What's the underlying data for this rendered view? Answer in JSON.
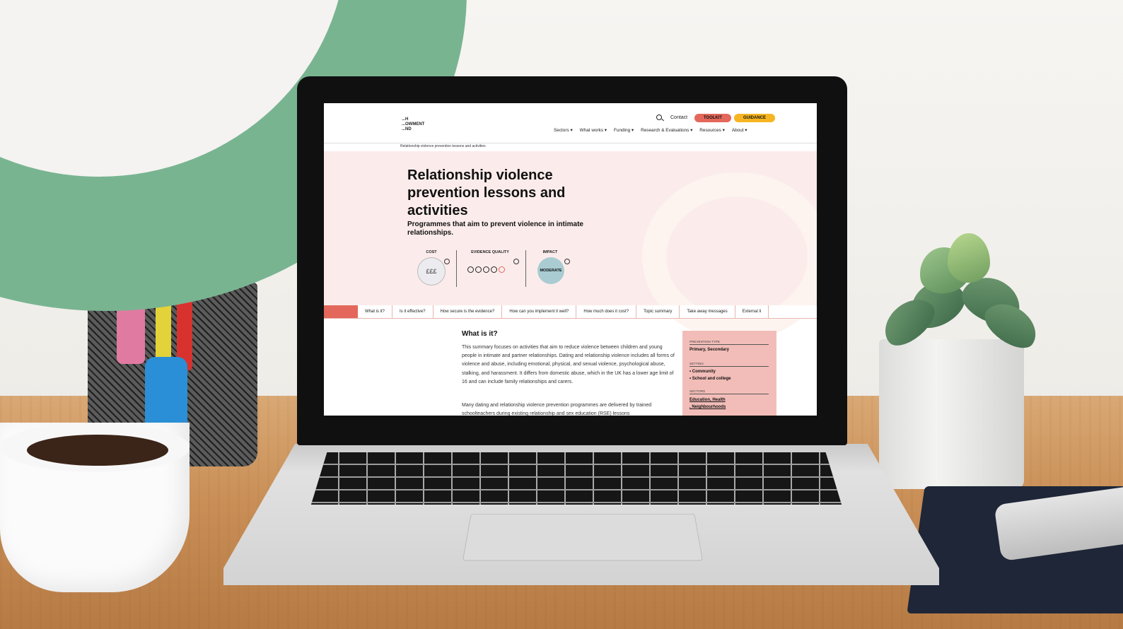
{
  "website": {
    "logo_lines": [
      "...H",
      "...OWMENT",
      "...ND"
    ],
    "contact": "Contact",
    "toolkit_button": "TOOLKIT",
    "guidance_button": "GUIDANCE",
    "nav": [
      "Sectors ▾",
      "What works ▾",
      "Funding ▾",
      "Research & Evaluations ▾",
      "Resources ▾",
      "About ▾"
    ],
    "breadcrumb": "Relationship violence prevention lessons and activities",
    "title": "Relationship violence prevention lessons and activities",
    "subtitle": "Programmes that aim to prevent violence in intimate relationships.",
    "metrics": {
      "cost_label": "COST",
      "cost_value": "£££",
      "evidence_label": "EVIDENCE QUALITY",
      "impact_label": "IMPACT",
      "impact_value": "MODERATE"
    },
    "tabs": [
      "What is it?",
      "Is it effective?",
      "How secure is the evidence?",
      "How can you implement it well?",
      "How much does it cost?",
      "Topic summary",
      "Take away messages",
      "External li"
    ],
    "section_title": "What is it?",
    "paragraph_1": "This summary focuses on activities that aim to reduce violence between children and young people in intimate and partner relationships. Dating and relationship violence includes all forms of violence and abuse, including emotional, physical, and sexual violence, psychological abuse, stalking, and harassment. It differs from domestic abuse, which in the UK has a lower age limit of 16 and can include family relationships and carers.",
    "paragraph_2": "Many dating and relationship violence prevention programmes are delivered by trained schoolteachers during existing relationship and sex education (RSE) lessons",
    "sidebar": {
      "prevention_type_label": "PREVENTION TYPE",
      "prevention_type": "Primary, Secondary",
      "setting_label": "SETTING",
      "setting_items": [
        "Community",
        "School and college"
      ],
      "sectors_label": "SECTORS",
      "sectors_line1": "Education, Health",
      "sectors_line2": ", Neighbourhoods"
    }
  },
  "colors": {
    "green_arc": "#79b491",
    "toolkit": "#e4675b",
    "guidance": "#f6b521",
    "hero_bg": "#fbeceb",
    "sidebar_bg": "#f2bdb8",
    "impact_circle": "#a9ccd2"
  }
}
